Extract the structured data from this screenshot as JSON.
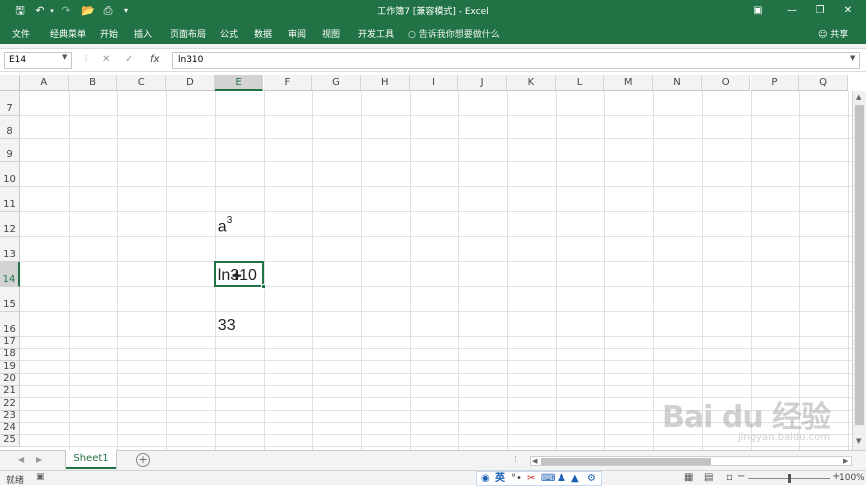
{
  "window": {
    "title": "工作簿7 [兼容模式] - Excel",
    "share_label": "共享"
  },
  "quick_access": [
    "save-icon",
    "undo-icon",
    "redo-icon",
    "open-icon",
    "print-preview-icon",
    "customize-icon"
  ],
  "menu": {
    "items": [
      "文件",
      "经典菜单",
      "开始",
      "插入",
      "页面布局",
      "公式",
      "数据",
      "审阅",
      "视图",
      "开发工具"
    ],
    "tell_me": "告诉我你想要做什么"
  },
  "formula_bar": {
    "name_box": "E14",
    "fx": "fx",
    "value": "ln310"
  },
  "grid": {
    "columns": [
      "A",
      "B",
      "C",
      "D",
      "E",
      "F",
      "G",
      "H",
      "I",
      "J",
      "K",
      "L",
      "M",
      "N",
      "O",
      "P",
      "Q"
    ],
    "selected_column": "E",
    "rows": [
      "7",
      "8",
      "9",
      "10",
      "11",
      "12",
      "13",
      "14",
      "15",
      "16",
      "17",
      "18",
      "19",
      "20",
      "21",
      "22",
      "23",
      "24",
      "25"
    ],
    "selected_row": "14",
    "cells": {
      "E12": {
        "base": "a",
        "sup": "3"
      },
      "E14": "ln310",
      "E16": "33"
    },
    "active_cell": "E14"
  },
  "sheets": {
    "tabs": [
      "Sheet1"
    ],
    "active": "Sheet1"
  },
  "status": {
    "ready": "就绪",
    "ime_label": "英",
    "zoom": "100%"
  },
  "watermark": {
    "main": "Bai du 经验",
    "sub": "jingyan.baidu.com"
  },
  "colors": {
    "accent": "#217346"
  }
}
